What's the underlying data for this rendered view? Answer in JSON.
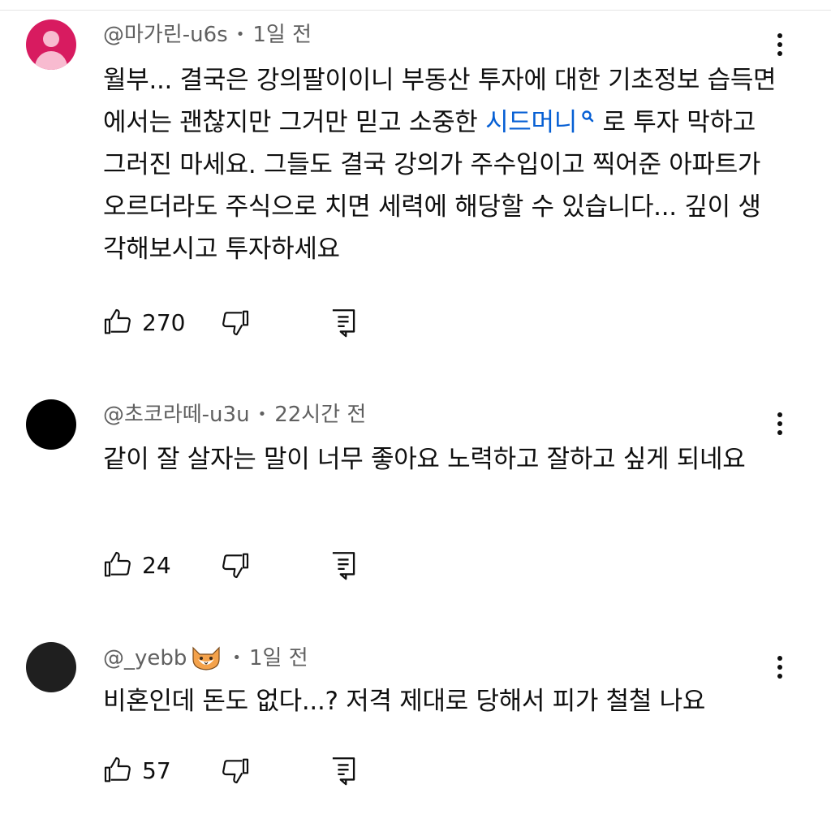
{
  "comments": [
    {
      "handle": "@마가린-u6s",
      "separator": "•",
      "time": "1일 전",
      "text_before_link": "월부... 결국은 강의팔이이니 부동산 투자에 대한 기초정보 습득면에서는 괜찮지만 그거만 믿고 소중한 ",
      "link_text": "시드머니",
      "text_after_link": " 로 투자 막하고 그러진 마세요. 그들도 결국 강의가 주수입이고 찍어준 아파트가 오르더라도 주식으로 치면 세력에 해당할 수 있습니다... 깊이 생각해보시고 투자하세요",
      "likes": "270",
      "avatar_color": "#d81b60"
    },
    {
      "handle": "@초코라떼-u3u",
      "separator": "•",
      "time": "22시간 전",
      "text": "같이 잘 살자는 말이 너무 좋아요 노력하고 잘하고 싶게 되네요",
      "likes": "24",
      "avatar_color": "#000000"
    },
    {
      "handle": "@_yebb",
      "separator": "•",
      "time": "1일 전",
      "text": "비혼인데 돈도 없다...? 저격 제대로 당해서 피가 철철 나요",
      "likes": "57",
      "avatar_color": "#1f1f1f"
    }
  ],
  "icons": {
    "like": "thumb-up-icon",
    "dislike": "thumb-down-icon",
    "reply": "reply-comment-icon",
    "more": "vertical-ellipsis-icon",
    "search_link": "search-icon",
    "badge": "fox-emoji-icon"
  },
  "colors": {
    "link": "#065fd4",
    "meta": "#606060",
    "text": "#0f0f0f"
  }
}
